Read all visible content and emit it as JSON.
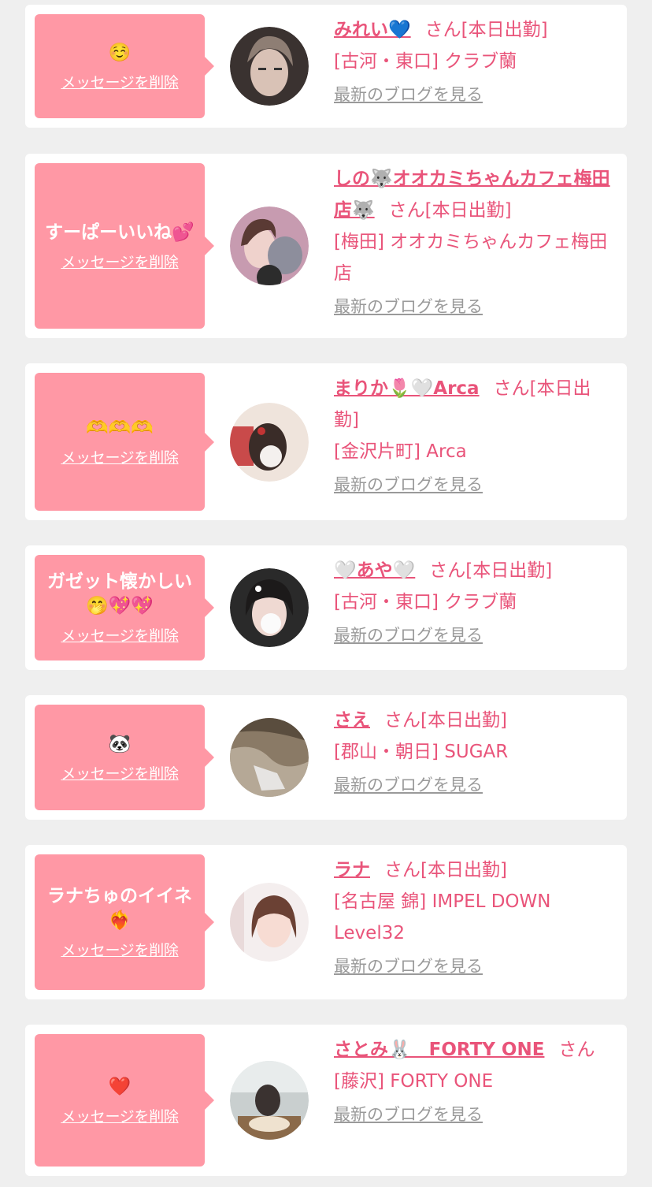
{
  "delete_label": "メッセージを削除",
  "blog_label": "最新のブログを見る",
  "colors": {
    "accent": "#e9547a",
    "bubble": "#ff98a5",
    "background": "#efefef"
  },
  "entries": [
    {
      "message": "☺️",
      "name": "みれい💙",
      "suffix": "さん[本日出勤]",
      "shop": "[古河・東口] クラブ蘭"
    },
    {
      "message": "すーぱーいいね💕",
      "name": "しの🐺オオカミちゃんカフェ梅田店🐺",
      "suffix": "さん[本日出勤]",
      "shop": "[梅田] オオカミちゃんカフェ梅田店"
    },
    {
      "message": "🫶🫶🫶",
      "name": "まりか🌷🤍Arca",
      "suffix": "さん[本日出勤]",
      "shop": "[金沢片町] Arca"
    },
    {
      "message": "ガゼット懐かしい🤭💖💖",
      "name": "🤍あや🤍",
      "suffix": "さん[本日出勤]",
      "shop": "[古河・東口] クラブ蘭"
    },
    {
      "message": "🐼",
      "name": "さえ",
      "suffix": "さん[本日出勤]",
      "shop": "[郡山・朝日] SUGAR"
    },
    {
      "message": "ラナちゅのイイネ❤️‍🔥",
      "name": "ラナ",
      "suffix": "さん[本日出勤]",
      "shop": "[名古屋 錦] IMPEL DOWN Level32"
    },
    {
      "message": "❤️",
      "name": "さとみ🐰　FORTY ONE",
      "suffix": "さん",
      "shop": "[藤沢] FORTY ONE"
    }
  ]
}
